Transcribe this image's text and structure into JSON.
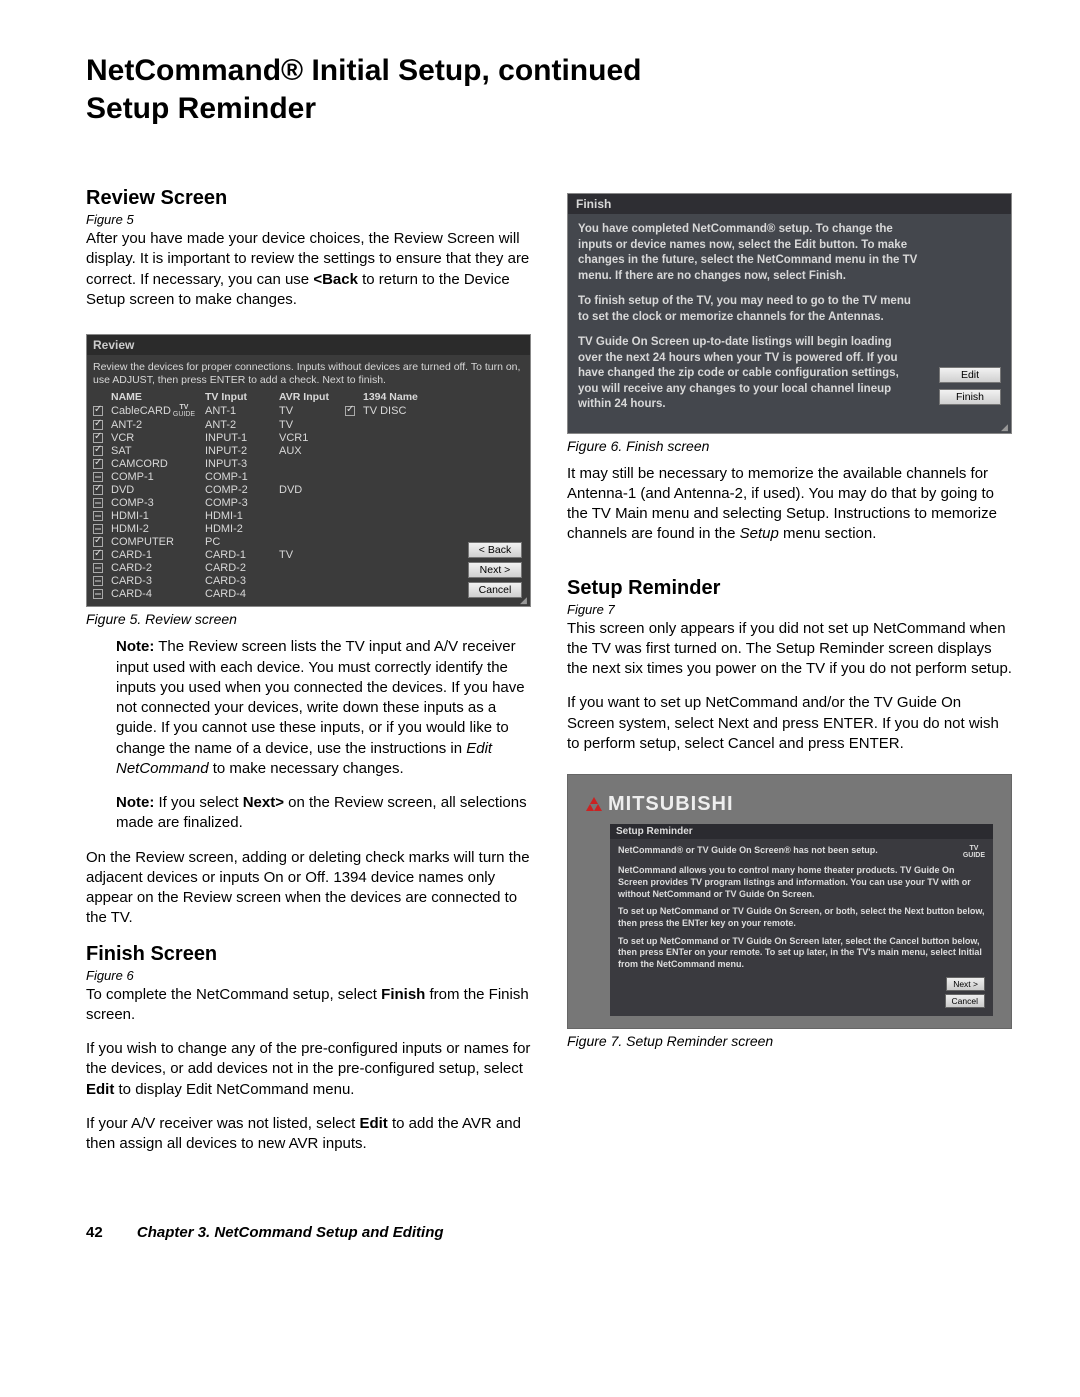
{
  "title_line1": "NetCommand® Initial Setup, continued",
  "title_line2": "Setup Reminder",
  "left": {
    "review_h": "Review Screen",
    "review_figref": "Figure 5",
    "review_p1_a": "After you have made your device choices, the Review Screen will display.  It is important to review the settings to ensure that they are correct.  If necessary, you can use ",
    "review_p1_bold": "<Back",
    "review_p1_b": " to return to the Device Setup screen to make changes.",
    "cap5": "Figure 5.  Review screen",
    "note1_a": "Note:",
    "note1_b": "  The Review screen lists the TV input and A/V receiver input used with each device.  You must correctly identify the inputs you used when you connected the devices.  If you have not connected your devices, write down these inputs as a guide.  If you cannot use these inputs, or if you would like to change the name of a device, use the instructions in ",
    "note1_i": "Edit NetCommand",
    "note1_c": " to make necessary changes.",
    "note2_a": "Note:",
    "note2_b": " If you select ",
    "note2_bold": "Next>",
    "note2_c": " on the Review screen, all selections made are finalized.",
    "review_p2": "On the Review screen, adding or deleting check marks will turn the adjacent devices or inputs On or Off.  1394 device names only appear on the Review screen when the devices are connected to the TV.",
    "finish_h": "Finish Screen",
    "finish_figref": "Figure 6",
    "finish_p1_a": "To complete the NetCommand setup, select ",
    "finish_p1_bold": "Finish",
    "finish_p1_b": " from the Finish screen.",
    "finish_p2_a": "If you wish to change any of the pre-configured inputs or names for the devices, or add devices not in the pre-configured setup, select ",
    "finish_p2_bold": "Edit",
    "finish_p2_b": " to display Edit NetCommand menu.",
    "finish_p3_a": "If your A/V receiver was not listed, select ",
    "finish_p3_bold": "Edit",
    "finish_p3_b": " to add the AVR and then assign all devices to new AVR inputs."
  },
  "right": {
    "cap6": "Figure 6. Finish screen",
    "right_p1_a": "It may still be necessary to memorize the available channels for Antenna-1 (and Antenna-2, if used).  You may do that by going to the TV Main menu and selecting Setup.  Instructions to memorize channels are found in the ",
    "right_p1_i": "Setup",
    "right_p1_b": " menu section.",
    "setup_h": "Setup Reminder",
    "setup_figref": "Figure 7",
    "setup_p1": "This screen only appears if you did not set up NetCommand when the TV was first turned on.  The Setup Reminder screen displays the next six times you power on the TV if you do not perform setup.",
    "setup_p2": "If you want to set up NetCommand and/or the TV Guide On Screen system, select Next and press ENTER.  If you do not wish to perform setup, select Cancel and press ENTER.",
    "cap7": "Figure 7.  Setup Reminder screen"
  },
  "fig5": {
    "title": "Review",
    "intro": "Review the devices for proper connections. Inputs without devices are turned off. To turn on, use ADJUST, then press ENTER to add a check.  Next to finish.",
    "h_name": "NAME",
    "h_tv": "TV  Input",
    "h_avr": "AVR Input",
    "h_1394": "1394 Name",
    "rows": [
      {
        "c": "on",
        "n": "CableCARD",
        "tv": "ANT-1",
        "avr": "TV",
        "d": "on",
        "dn": "TV DISC",
        "tvg": true
      },
      {
        "c": "on",
        "n": "ANT-2",
        "tv": "ANT-2",
        "avr": "TV"
      },
      {
        "c": "on",
        "n": "VCR",
        "tv": "INPUT-1",
        "avr": "VCR1"
      },
      {
        "c": "on",
        "n": "SAT",
        "tv": "INPUT-2",
        "avr": "AUX"
      },
      {
        "c": "on",
        "n": "CAMCORD",
        "tv": "INPUT-3",
        "avr": ""
      },
      {
        "c": "dot",
        "n": "COMP-1",
        "tv": "COMP-1",
        "avr": ""
      },
      {
        "c": "on",
        "n": "DVD",
        "tv": "COMP-2",
        "avr": "DVD"
      },
      {
        "c": "dot",
        "n": "COMP-3",
        "tv": "COMP-3",
        "avr": ""
      },
      {
        "c": "dot",
        "n": "HDMI-1",
        "tv": "HDMI-1",
        "avr": ""
      },
      {
        "c": "dot",
        "n": "HDMI-2",
        "tv": "HDMI-2",
        "avr": ""
      },
      {
        "c": "on",
        "n": "COMPUTER",
        "tv": "PC",
        "avr": ""
      },
      {
        "c": "on",
        "n": "CARD-1",
        "tv": "CARD-1",
        "avr": "TV"
      },
      {
        "c": "dot",
        "n": "CARD-2",
        "tv": "CARD-2",
        "avr": ""
      },
      {
        "c": "dot",
        "n": "CARD-3",
        "tv": "CARD-3",
        "avr": ""
      },
      {
        "c": "dot",
        "n": "CARD-4",
        "tv": "CARD-4",
        "avr": ""
      }
    ],
    "b_back": "< Back",
    "b_next": "Next >",
    "b_cancel": "Cancel"
  },
  "fig6": {
    "title": "Finish",
    "p1": "You have completed NetCommand® setup.  To change the inputs or device names now, select the Edit button.  To make changes in the future, select the NetCommand menu in the TV menu.  If there are no changes now, select Finish.",
    "p2": "To finish setup of the TV, you may need to go to the TV menu to set the clock or memorize channels for the Antennas.",
    "p3": "TV Guide On Screen up-to-date listings will begin loading over the next 24 hours when your TV is powered off.  If you have changed the zip code or cable configuration settings, you will receive any changes to your local channel lineup within 24 hours.",
    "b_edit": "Edit",
    "b_finish": "Finish"
  },
  "fig7": {
    "brand": "MITSUBISHI",
    "title": "Setup Reminder",
    "p1": "NetCommand® or TV Guide On Screen® has not been setup.",
    "p2": "NetCommand allows you to control many home theater products. TV Guide On Screen provides TV program listings and information.  You can use your TV with or without NetCommand or TV Guide On Screen.",
    "p3": "To set up NetCommand or TV Guide On Screen, or both, select the Next button below, then press the ENTer key on your remote.",
    "p4": "To set up NetCommand or TV Guide On Screen later, select the Cancel button below, then press ENTer on your remote.   To set up later, in the TV's main menu, select Initial from the NetCommand menu.",
    "b_next": "Next >",
    "b_cancel": "Cancel"
  },
  "footer": {
    "page": "42",
    "chapter": "Chapter 3. NetCommand Setup and Editing"
  }
}
